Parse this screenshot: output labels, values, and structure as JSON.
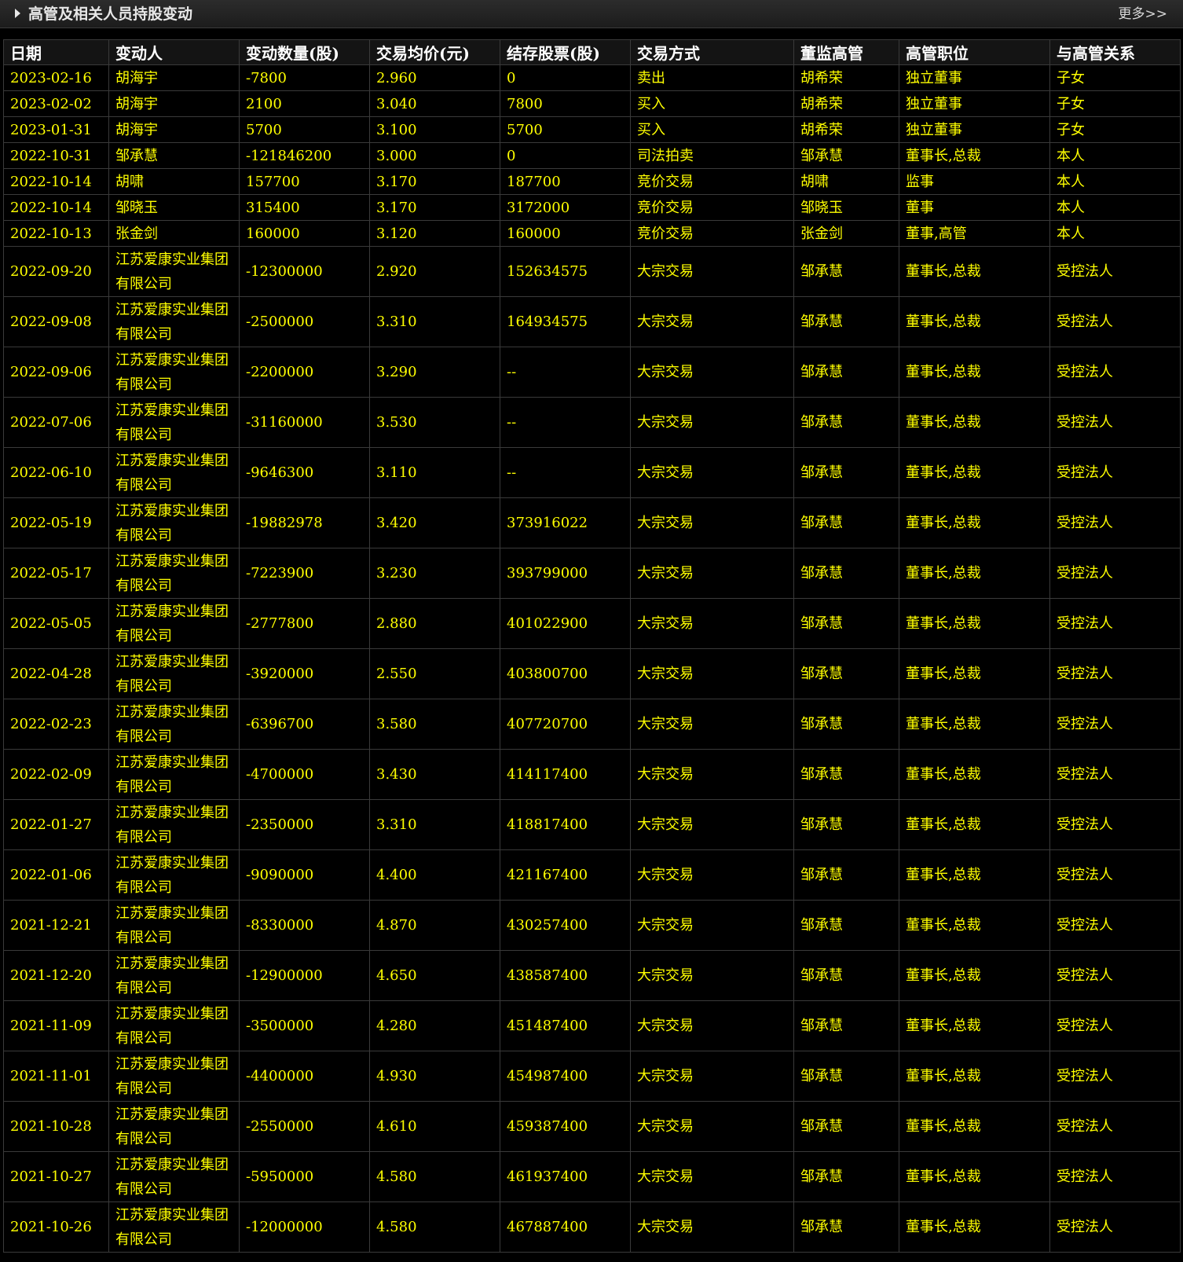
{
  "header": {
    "title": "高管及相关人员持股变动",
    "more": "更多>>"
  },
  "columns": [
    "日期",
    "变动人",
    "变动数量(股)",
    "交易均价(元)",
    "结存股票(股)",
    "交易方式",
    "董监高管",
    "高管职位",
    "与高管关系"
  ],
  "rows": [
    [
      "2023-02-16",
      "胡海宇",
      "-7800",
      "2.960",
      "0",
      "卖出",
      "胡希荣",
      "独立董事",
      "子女"
    ],
    [
      "2023-02-02",
      "胡海宇",
      "2100",
      "3.040",
      "7800",
      "买入",
      "胡希荣",
      "独立董事",
      "子女"
    ],
    [
      "2023-01-31",
      "胡海宇",
      "5700",
      "3.100",
      "5700",
      "买入",
      "胡希荣",
      "独立董事",
      "子女"
    ],
    [
      "2022-10-31",
      "邹承慧",
      "-121846200",
      "3.000",
      "0",
      "司法拍卖",
      "邹承慧",
      "董事长,总裁",
      "本人"
    ],
    [
      "2022-10-14",
      "胡啸",
      "157700",
      "3.170",
      "187700",
      "竞价交易",
      "胡啸",
      "监事",
      "本人"
    ],
    [
      "2022-10-14",
      "邹晓玉",
      "315400",
      "3.170",
      "3172000",
      "竞价交易",
      "邹晓玉",
      "董事",
      "本人"
    ],
    [
      "2022-10-13",
      "张金剑",
      "160000",
      "3.120",
      "160000",
      "竞价交易",
      "张金剑",
      "董事,高管",
      "本人"
    ],
    [
      "2022-09-20",
      "江苏爱康实业集团有限公司",
      "-12300000",
      "2.920",
      "152634575",
      "大宗交易",
      "邹承慧",
      "董事长,总裁",
      "受控法人"
    ],
    [
      "2022-09-08",
      "江苏爱康实业集团有限公司",
      "-2500000",
      "3.310",
      "164934575",
      "大宗交易",
      "邹承慧",
      "董事长,总裁",
      "受控法人"
    ],
    [
      "2022-09-06",
      "江苏爱康实业集团有限公司",
      "-2200000",
      "3.290",
      "--",
      "大宗交易",
      "邹承慧",
      "董事长,总裁",
      "受控法人"
    ],
    [
      "2022-07-06",
      "江苏爱康实业集团有限公司",
      "-31160000",
      "3.530",
      "--",
      "大宗交易",
      "邹承慧",
      "董事长,总裁",
      "受控法人"
    ],
    [
      "2022-06-10",
      "江苏爱康实业集团有限公司",
      "-9646300",
      "3.110",
      "--",
      "大宗交易",
      "邹承慧",
      "董事长,总裁",
      "受控法人"
    ],
    [
      "2022-05-19",
      "江苏爱康实业集团有限公司",
      "-19882978",
      "3.420",
      "373916022",
      "大宗交易",
      "邹承慧",
      "董事长,总裁",
      "受控法人"
    ],
    [
      "2022-05-17",
      "江苏爱康实业集团有限公司",
      "-7223900",
      "3.230",
      "393799000",
      "大宗交易",
      "邹承慧",
      "董事长,总裁",
      "受控法人"
    ],
    [
      "2022-05-05",
      "江苏爱康实业集团有限公司",
      "-2777800",
      "2.880",
      "401022900",
      "大宗交易",
      "邹承慧",
      "董事长,总裁",
      "受控法人"
    ],
    [
      "2022-04-28",
      "江苏爱康实业集团有限公司",
      "-3920000",
      "2.550",
      "403800700",
      "大宗交易",
      "邹承慧",
      "董事长,总裁",
      "受控法人"
    ],
    [
      "2022-02-23",
      "江苏爱康实业集团有限公司",
      "-6396700",
      "3.580",
      "407720700",
      "大宗交易",
      "邹承慧",
      "董事长,总裁",
      "受控法人"
    ],
    [
      "2022-02-09",
      "江苏爱康实业集团有限公司",
      "-4700000",
      "3.430",
      "414117400",
      "大宗交易",
      "邹承慧",
      "董事长,总裁",
      "受控法人"
    ],
    [
      "2022-01-27",
      "江苏爱康实业集团有限公司",
      "-2350000",
      "3.310",
      "418817400",
      "大宗交易",
      "邹承慧",
      "董事长,总裁",
      "受控法人"
    ],
    [
      "2022-01-06",
      "江苏爱康实业集团有限公司",
      "-9090000",
      "4.400",
      "421167400",
      "大宗交易",
      "邹承慧",
      "董事长,总裁",
      "受控法人"
    ],
    [
      "2021-12-21",
      "江苏爱康实业集团有限公司",
      "-8330000",
      "4.870",
      "430257400",
      "大宗交易",
      "邹承慧",
      "董事长,总裁",
      "受控法人"
    ],
    [
      "2021-12-20",
      "江苏爱康实业集团有限公司",
      "-12900000",
      "4.650",
      "438587400",
      "大宗交易",
      "邹承慧",
      "董事长,总裁",
      "受控法人"
    ],
    [
      "2021-11-09",
      "江苏爱康实业集团有限公司",
      "-3500000",
      "4.280",
      "451487400",
      "大宗交易",
      "邹承慧",
      "董事长,总裁",
      "受控法人"
    ],
    [
      "2021-11-01",
      "江苏爱康实业集团有限公司",
      "-4400000",
      "4.930",
      "454987400",
      "大宗交易",
      "邹承慧",
      "董事长,总裁",
      "受控法人"
    ],
    [
      "2021-10-28",
      "江苏爱康实业集团有限公司",
      "-2550000",
      "4.610",
      "459387400",
      "大宗交易",
      "邹承慧",
      "董事长,总裁",
      "受控法人"
    ],
    [
      "2021-10-27",
      "江苏爱康实业集团有限公司",
      "-5950000",
      "4.580",
      "461937400",
      "大宗交易",
      "邹承慧",
      "董事长,总裁",
      "受控法人"
    ],
    [
      "2021-10-26",
      "江苏爱康实业集团有限公司",
      "-12000000",
      "4.580",
      "467887400",
      "大宗交易",
      "邹承慧",
      "董事长,总裁",
      "受控法人"
    ]
  ]
}
